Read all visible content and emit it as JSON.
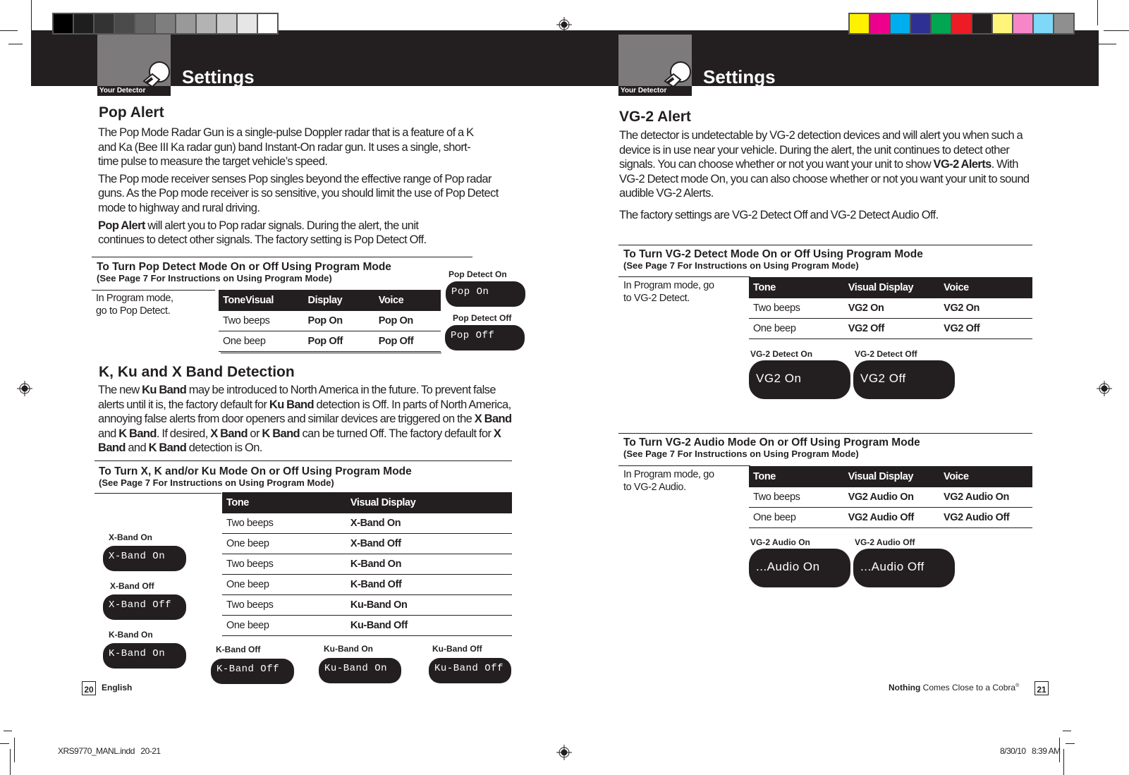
{
  "color_bar": {
    "grays": [
      "#000000",
      "#1e1e1e",
      "#333333",
      "#4b4b4b",
      "#656565",
      "#7e7e7e",
      "#999999",
      "#b3b3b3",
      "#cccccc",
      "#e6e6e6",
      "#ffffff"
    ],
    "colors": [
      "#fff200",
      "#ec008c",
      "#00aeef",
      "#2e3192",
      "#00a651",
      "#ed1c24",
      "#231f20",
      "#fff57a",
      "#f587c8",
      "#7fd8f8",
      "#8f8f8f"
    ]
  },
  "header": {
    "left": {
      "tab_label": "Your Detector",
      "title": "Settings"
    },
    "right": {
      "tab_label": "Your Detector",
      "title": "Settings"
    }
  },
  "left_page": {
    "pop_alert": {
      "heading": "Pop Alert",
      "paragraphs": [
        "The Pop Mode Radar Gun is a single-pulse Doppler radar that is a feature of a K and Ka (Bee III Ka radar gun) band Instant-On radar gun. It uses a single, short-time pulse to measure the target vehicle’s speed.",
        "The Pop mode receiver senses Pop singles beyond the effective range of Pop radar guns. As the Pop mode receiver is so sensitive, you should limit the use of Pop Detect mode to highway and rural driving."
      ],
      "p3_bold": "Pop Alert",
      "p3_rest": " will alert you to Pop radar signals. During the alert, the unit continues to detect other signals. The factory setting is Pop Detect Off.",
      "section_title": "To Turn Pop Detect Mode On or Off Using Program Mode",
      "section_sub": "(See Page 7 For Instructions on Using Program Mode)",
      "instruction": "In Program mode, go to Pop Detect.",
      "table": {
        "headers": [
          "ToneVisual",
          "Display",
          "Voice"
        ],
        "rows": [
          [
            "Two beeps",
            "Pop On",
            "Pop On"
          ],
          [
            "One beep",
            "Pop Off",
            "Pop Off"
          ]
        ]
      },
      "displays": [
        {
          "label": "Pop Detect On",
          "screen": "Pop On"
        },
        {
          "label": "Pop Detect Off",
          "screen": "Pop Off"
        }
      ]
    },
    "band_detection": {
      "heading": "K, Ku and X Band Detection",
      "paragraph_parts": [
        {
          "t": "The new ",
          "b": false
        },
        {
          "t": "Ku Band",
          "b": true
        },
        {
          "t": " may be introduced to North America in the future. To prevent false alerts until it is, the factory default for ",
          "b": false
        },
        {
          "t": "Ku Band",
          "b": true
        },
        {
          "t": " detection is Off. In parts of North America, annoying false alerts from door openers and similar devices are triggered on the ",
          "b": false
        },
        {
          "t": "X Band",
          "b": true
        },
        {
          "t": " and ",
          "b": false
        },
        {
          "t": "K Band",
          "b": true
        },
        {
          "t": ". If desired, ",
          "b": false
        },
        {
          "t": "X Band",
          "b": true
        },
        {
          "t": " or ",
          "b": false
        },
        {
          "t": "K Band",
          "b": true
        },
        {
          "t": " can be turned Off. The factory default for ",
          "b": false
        },
        {
          "t": "X Band",
          "b": true
        },
        {
          "t": " and ",
          "b": false
        },
        {
          "t": "K Band",
          "b": true
        },
        {
          "t": " detection is On.",
          "b": false
        }
      ],
      "section_title": "To Turn X, K and/or Ku Mode On or Off Using Program Mode",
      "section_sub": "(See Page 7 For Instructions on Using Program Mode)",
      "table": {
        "headers": [
          "Tone",
          "Visual Display"
        ],
        "rows": [
          [
            "Two beeps",
            "X-Band On"
          ],
          [
            "One beep",
            "X-Band Off"
          ],
          [
            "Two beeps",
            "K-Band On"
          ],
          [
            "One beep",
            "K-Band Off"
          ],
          [
            "Two beeps",
            "Ku-Band On"
          ],
          [
            "One beep",
            "Ku-Band Off"
          ]
        ]
      },
      "displays": [
        {
          "label": "X-Band On",
          "screen": "X-Band On"
        },
        {
          "label": "X-Band Off",
          "screen": "X-Band Off"
        },
        {
          "label": "K-Band On",
          "screen": "K-Band On"
        },
        {
          "label": "K-Band Off",
          "screen": "K-Band Off"
        },
        {
          "label": "Ku-Band On",
          "screen": "Ku-Band On"
        },
        {
          "label": "Ku-Band Off",
          "screen": "Ku-Band Off"
        }
      ]
    },
    "footer": {
      "page_number": "20",
      "language": "English"
    }
  },
  "right_page": {
    "vg2_alert": {
      "heading": "VG-2 Alert",
      "p1_a": "The detector is undetectable by VG-2 detection devices and will alert you when such a device is in use near your vehicle. During the alert, the unit continues to detect other signals. You can choose whether or not you want your unit to show ",
      "p1_bold": "VG-2 Alerts",
      "p1_b": ". With VG-2 Detect mode On, you can also choose whether or not you want your unit to sound audible VG-2 Alerts.",
      "p2": "The factory settings are VG-2 Detect Off and VG-2 Detect Audio Off."
    },
    "detect_section": {
      "section_title": "To Turn VG-2 Detect Mode On or Off Using Program Mode",
      "section_sub": "(See Page 7 For Instructions on Using Program Mode)",
      "instruction": "In Program mode, go to VG-2 Detect.",
      "table": {
        "headers": [
          "Tone",
          "Visual Display",
          "Voice"
        ],
        "rows": [
          [
            "Two beeps",
            "VG2 On",
            "VG2 On"
          ],
          [
            "One beep",
            "VG2 Off",
            "VG2 Off"
          ]
        ]
      },
      "displays": [
        {
          "label": "VG-2 Detect On",
          "screen": "VG2 On"
        },
        {
          "label": "VG-2 Detect Off",
          "screen": "VG2 Off"
        }
      ]
    },
    "audio_section": {
      "section_title": "To Turn VG-2 Audio Mode On or Off Using Program Mode",
      "section_sub": "(See Page 7 For Instructions on Using Program Mode)",
      "instruction": "In Program mode, go to VG-2 Audio.",
      "table": {
        "headers": [
          "Tone",
          "Visual Display",
          "Voice"
        ],
        "rows": [
          [
            "Two beeps",
            "VG2 Audio On",
            "VG2 Audio On"
          ],
          [
            "One beep",
            "VG2 Audio Off",
            "VG2 Audio Off"
          ]
        ]
      },
      "displays": [
        {
          "label": "VG-2 Audio On",
          "screen": "...Audio On"
        },
        {
          "label": "VG-2 Audio Off",
          "screen": "...Audio Off"
        }
      ]
    },
    "footer": {
      "tagline_bold": "Nothing",
      "tagline_rest": " Comes Close to a Cobra",
      "registered": "®",
      "page_number": "21"
    }
  },
  "slug": {
    "file": "XRS9770_MANL.indd   20-21",
    "timestamp": "8/30/10   8:39 AM"
  }
}
